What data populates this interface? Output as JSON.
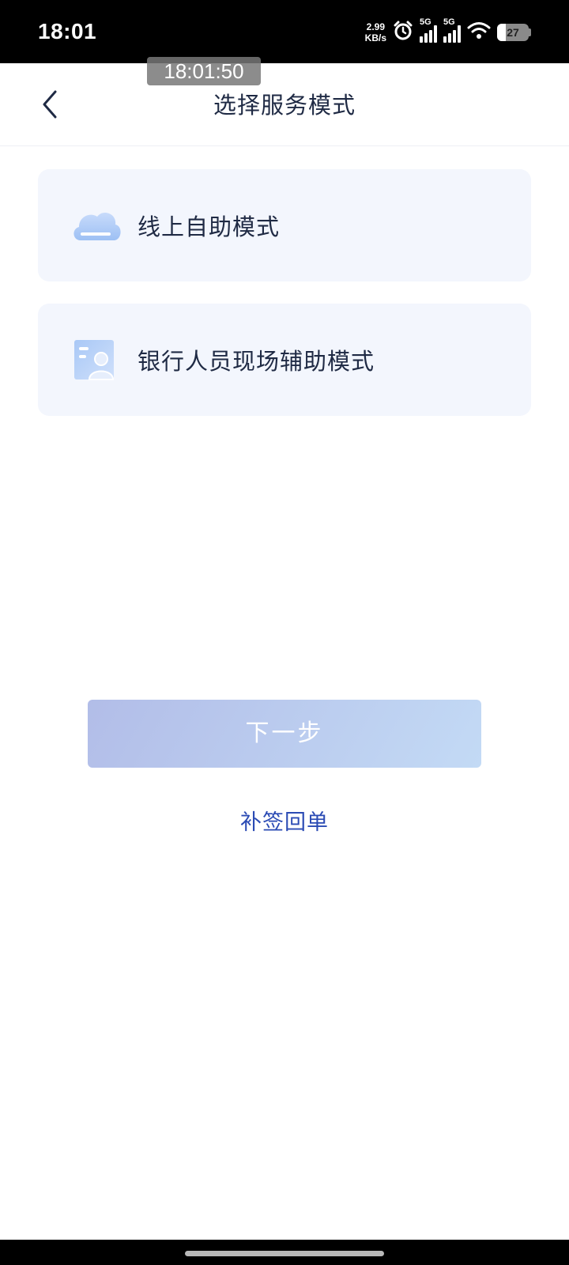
{
  "status_bar": {
    "time": "18:01",
    "net_speed_value": "2.99",
    "net_speed_unit": "KB/s",
    "sim1_label": "5G",
    "sim2_label": "5G",
    "battery_level": "27",
    "battery_percent": 27
  },
  "time_overlay": "18:01:50",
  "header": {
    "title": "选择服务模式"
  },
  "options": [
    {
      "label": "线上自助模式",
      "icon": "cloud-icon"
    },
    {
      "label": "银行人员现场辅助模式",
      "icon": "staff-card-icon"
    }
  ],
  "actions": {
    "next_label": "下一步",
    "resign_label": "补签回单"
  },
  "colors": {
    "title_text": "#1f2a44",
    "card_bg": "#f3f6fd",
    "link": "#2b4bb4",
    "button_gradient_start": "#b2bde8",
    "button_gradient_end": "#c3daf5"
  }
}
